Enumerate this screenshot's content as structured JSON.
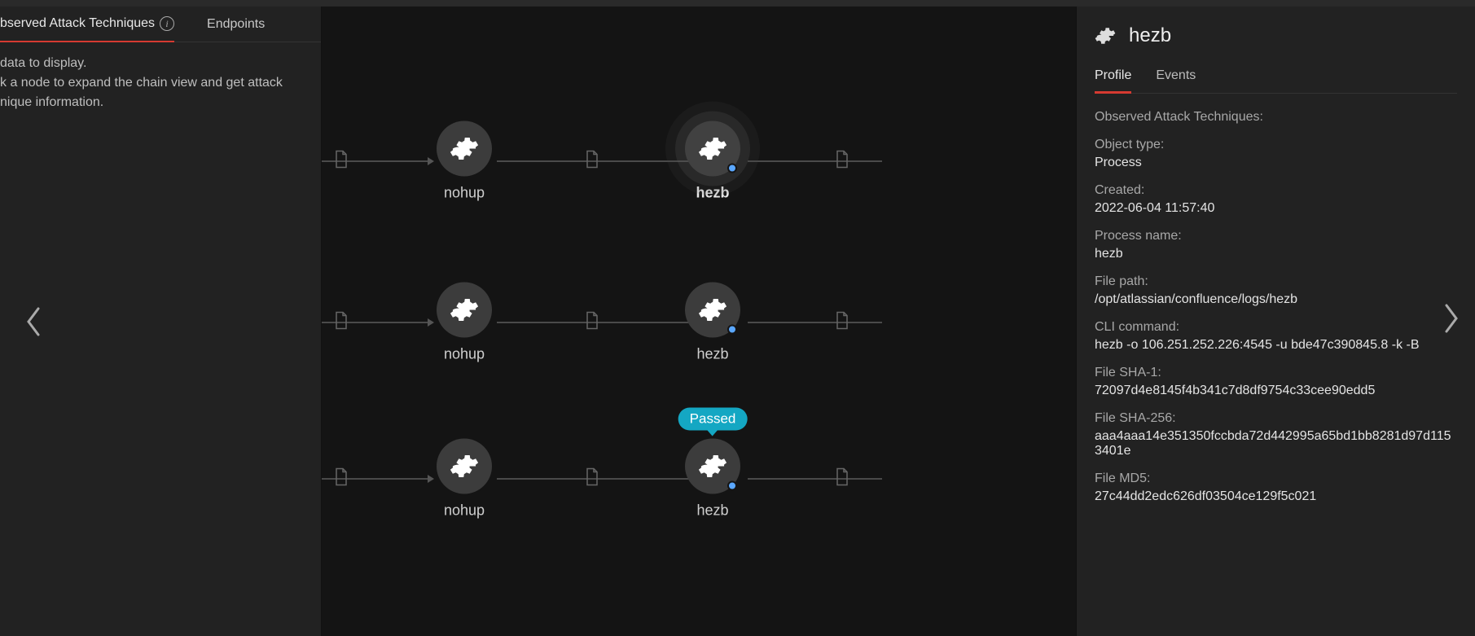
{
  "left_panel": {
    "tabs": [
      {
        "label": "bserved Attack Techniques",
        "active": true
      },
      {
        "label": "Endpoints",
        "active": false
      }
    ],
    "message_line1": "data to display.",
    "message_line2": "k a node to expand the chain view and get attack",
    "message_line3": "nique information."
  },
  "graph": {
    "rows": [
      {
        "nodes": [
          {
            "label": "nohup",
            "selected": false,
            "dot": false
          },
          {
            "label": "hezb",
            "selected": true,
            "dot": true
          }
        ]
      },
      {
        "nodes": [
          {
            "label": "nohup",
            "selected": false,
            "dot": false
          },
          {
            "label": "hezb",
            "selected": false,
            "dot": true
          }
        ]
      },
      {
        "nodes": [
          {
            "label": "nohup",
            "selected": false,
            "dot": false
          },
          {
            "label": "hezb",
            "selected": false,
            "dot": true,
            "badge": "Passed"
          }
        ]
      }
    ]
  },
  "right_panel": {
    "title": "hezb",
    "tabs": [
      {
        "label": "Profile",
        "active": true
      },
      {
        "label": "Events",
        "active": false
      }
    ],
    "fields": [
      {
        "label": "Observed Attack Techniques:",
        "value": ""
      },
      {
        "label": "Object type:",
        "value": "Process"
      },
      {
        "label": "Created:",
        "value": "2022-06-04 11:57:40"
      },
      {
        "label": "Process name:",
        "value": "hezb"
      },
      {
        "label": "File path:",
        "value": "/opt/atlassian/confluence/logs/hezb"
      },
      {
        "label": "CLI command:",
        "value": "hezb -o 106.251.252.226:4545 -u bde47c390845.8 -k -B"
      },
      {
        "label": "File SHA-1:",
        "value": "72097d4e8145f4b341c7d8df9754c33cee90edd5"
      },
      {
        "label": "File SHA-256:",
        "value": "aaa4aaa14e351350fccbda72d442995a65bd1bb8281d97d1153401e"
      },
      {
        "label": "File MD5:",
        "value": "27c44dd2edc626df03504ce129f5c021"
      }
    ]
  }
}
